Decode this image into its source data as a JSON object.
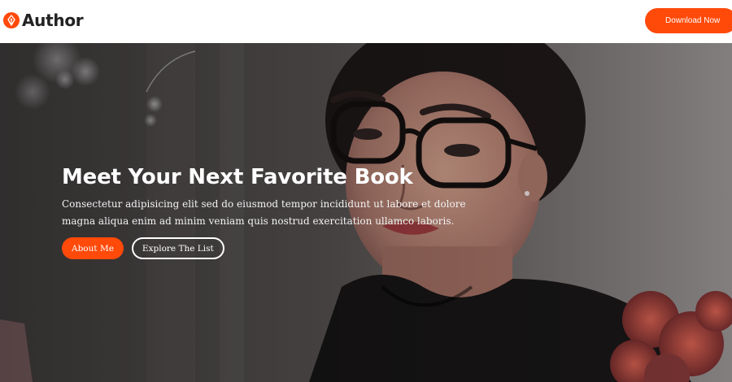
{
  "header": {
    "logo_text": "Author",
    "download_label": "Download Now"
  },
  "hero": {
    "title": "Meet Your Next Favorite Book",
    "subtitle_line1": "Consectetur adipisicing elit sed do eiusmod tempor incididunt ut labore et dolore",
    "subtitle_line2": "magna aliqua enim ad minim veniam quis nostrud exercitation ullamco laboris.",
    "primary_label": "About Me",
    "secondary_label": "Explore The List"
  },
  "colors": {
    "accent": "#ff4a0a",
    "header_bg": "#ffffff",
    "text_light": "#ffffff"
  },
  "icons": {
    "logo": "pen-nib-icon"
  }
}
